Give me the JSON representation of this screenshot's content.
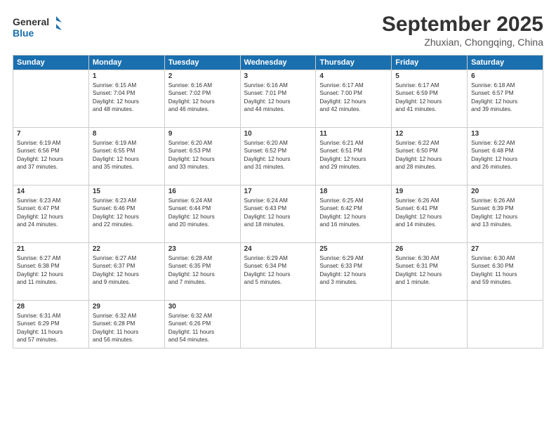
{
  "header": {
    "logo_line1": "General",
    "logo_line2": "Blue",
    "main_title": "September 2025",
    "subtitle": "Zhuxian, Chongqing, China"
  },
  "weekdays": [
    "Sunday",
    "Monday",
    "Tuesday",
    "Wednesday",
    "Thursday",
    "Friday",
    "Saturday"
  ],
  "weeks": [
    [
      {
        "date": "",
        "info": ""
      },
      {
        "date": "1",
        "info": "Sunrise: 6:15 AM\nSunset: 7:04 PM\nDaylight: 12 hours\nand 48 minutes."
      },
      {
        "date": "2",
        "info": "Sunrise: 6:16 AM\nSunset: 7:02 PM\nDaylight: 12 hours\nand 46 minutes."
      },
      {
        "date": "3",
        "info": "Sunrise: 6:16 AM\nSunset: 7:01 PM\nDaylight: 12 hours\nand 44 minutes."
      },
      {
        "date": "4",
        "info": "Sunrise: 6:17 AM\nSunset: 7:00 PM\nDaylight: 12 hours\nand 42 minutes."
      },
      {
        "date": "5",
        "info": "Sunrise: 6:17 AM\nSunset: 6:59 PM\nDaylight: 12 hours\nand 41 minutes."
      },
      {
        "date": "6",
        "info": "Sunrise: 6:18 AM\nSunset: 6:57 PM\nDaylight: 12 hours\nand 39 minutes."
      }
    ],
    [
      {
        "date": "7",
        "info": "Sunrise: 6:19 AM\nSunset: 6:56 PM\nDaylight: 12 hours\nand 37 minutes."
      },
      {
        "date": "8",
        "info": "Sunrise: 6:19 AM\nSunset: 6:55 PM\nDaylight: 12 hours\nand 35 minutes."
      },
      {
        "date": "9",
        "info": "Sunrise: 6:20 AM\nSunset: 6:53 PM\nDaylight: 12 hours\nand 33 minutes."
      },
      {
        "date": "10",
        "info": "Sunrise: 6:20 AM\nSunset: 6:52 PM\nDaylight: 12 hours\nand 31 minutes."
      },
      {
        "date": "11",
        "info": "Sunrise: 6:21 AM\nSunset: 6:51 PM\nDaylight: 12 hours\nand 29 minutes."
      },
      {
        "date": "12",
        "info": "Sunrise: 6:22 AM\nSunset: 6:50 PM\nDaylight: 12 hours\nand 28 minutes."
      },
      {
        "date": "13",
        "info": "Sunrise: 6:22 AM\nSunset: 6:48 PM\nDaylight: 12 hours\nand 26 minutes."
      }
    ],
    [
      {
        "date": "14",
        "info": "Sunrise: 6:23 AM\nSunset: 6:47 PM\nDaylight: 12 hours\nand 24 minutes."
      },
      {
        "date": "15",
        "info": "Sunrise: 6:23 AM\nSunset: 6:46 PM\nDaylight: 12 hours\nand 22 minutes."
      },
      {
        "date": "16",
        "info": "Sunrise: 6:24 AM\nSunset: 6:44 PM\nDaylight: 12 hours\nand 20 minutes."
      },
      {
        "date": "17",
        "info": "Sunrise: 6:24 AM\nSunset: 6:43 PM\nDaylight: 12 hours\nand 18 minutes."
      },
      {
        "date": "18",
        "info": "Sunrise: 6:25 AM\nSunset: 6:42 PM\nDaylight: 12 hours\nand 16 minutes."
      },
      {
        "date": "19",
        "info": "Sunrise: 6:26 AM\nSunset: 6:41 PM\nDaylight: 12 hours\nand 14 minutes."
      },
      {
        "date": "20",
        "info": "Sunrise: 6:26 AM\nSunset: 6:39 PM\nDaylight: 12 hours\nand 13 minutes."
      }
    ],
    [
      {
        "date": "21",
        "info": "Sunrise: 6:27 AM\nSunset: 6:38 PM\nDaylight: 12 hours\nand 11 minutes."
      },
      {
        "date": "22",
        "info": "Sunrise: 6:27 AM\nSunset: 6:37 PM\nDaylight: 12 hours\nand 9 minutes."
      },
      {
        "date": "23",
        "info": "Sunrise: 6:28 AM\nSunset: 6:35 PM\nDaylight: 12 hours\nand 7 minutes."
      },
      {
        "date": "24",
        "info": "Sunrise: 6:29 AM\nSunset: 6:34 PM\nDaylight: 12 hours\nand 5 minutes."
      },
      {
        "date": "25",
        "info": "Sunrise: 6:29 AM\nSunset: 6:33 PM\nDaylight: 12 hours\nand 3 minutes."
      },
      {
        "date": "26",
        "info": "Sunrise: 6:30 AM\nSunset: 6:31 PM\nDaylight: 12 hours\nand 1 minute."
      },
      {
        "date": "27",
        "info": "Sunrise: 6:30 AM\nSunset: 6:30 PM\nDaylight: 11 hours\nand 59 minutes."
      }
    ],
    [
      {
        "date": "28",
        "info": "Sunrise: 6:31 AM\nSunset: 6:29 PM\nDaylight: 11 hours\nand 57 minutes."
      },
      {
        "date": "29",
        "info": "Sunrise: 6:32 AM\nSunset: 6:28 PM\nDaylight: 11 hours\nand 56 minutes."
      },
      {
        "date": "30",
        "info": "Sunrise: 6:32 AM\nSunset: 6:26 PM\nDaylight: 11 hours\nand 54 minutes."
      },
      {
        "date": "",
        "info": ""
      },
      {
        "date": "",
        "info": ""
      },
      {
        "date": "",
        "info": ""
      },
      {
        "date": "",
        "info": ""
      }
    ]
  ]
}
